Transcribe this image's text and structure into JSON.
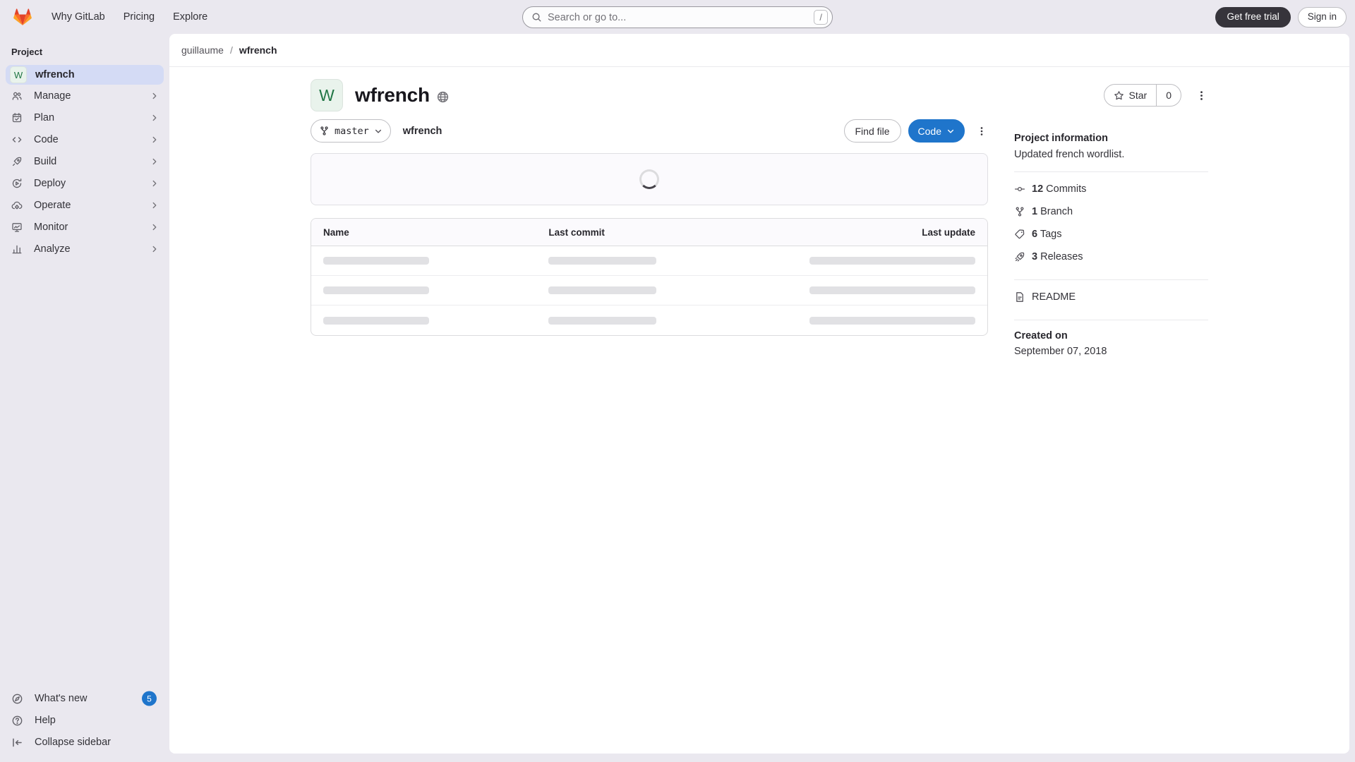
{
  "topbar": {
    "links": [
      {
        "label": "Why GitLab"
      },
      {
        "label": "Pricing"
      },
      {
        "label": "Explore"
      }
    ],
    "search": {
      "placeholder": "Search or go to...",
      "shortcut_key": "/"
    },
    "trial_button": "Get free trial",
    "signin_button": "Sign in"
  },
  "sidebar": {
    "heading": "Project",
    "project_item": {
      "initial": "W",
      "label": "wfrench"
    },
    "items": [
      {
        "icon": "manage-icon",
        "label": "Manage"
      },
      {
        "icon": "plan-icon",
        "label": "Plan"
      },
      {
        "icon": "code-icon",
        "label": "Code"
      },
      {
        "icon": "build-icon",
        "label": "Build"
      },
      {
        "icon": "deploy-icon",
        "label": "Deploy"
      },
      {
        "icon": "operate-icon",
        "label": "Operate"
      },
      {
        "icon": "monitor-icon",
        "label": "Monitor"
      },
      {
        "icon": "analyze-icon",
        "label": "Analyze"
      }
    ],
    "footer": [
      {
        "icon": "whats-new-icon",
        "label": "What's new",
        "badge": "5"
      },
      {
        "icon": "help-icon",
        "label": "Help"
      },
      {
        "icon": "collapse-sidebar-icon",
        "label": "Collapse sidebar"
      }
    ]
  },
  "breadcrumb": {
    "parent": "guillaume",
    "separator": "/",
    "current": "wfrench"
  },
  "project_header": {
    "avatar_initial": "W",
    "title": "wfrench",
    "visibility_icon": "globe-icon",
    "star_label": "Star",
    "star_count": "0"
  },
  "toolbar": {
    "branch": "master",
    "path_label": "wfrench",
    "find_file_label": "Find file",
    "code_label": "Code"
  },
  "file_table": {
    "headers": [
      "Name",
      "Last commit",
      "Last update"
    ],
    "skeleton_rows": 3,
    "state": "loading"
  },
  "project_info": {
    "title": "Project information",
    "description": "Updated french wordlist.",
    "stats": [
      {
        "icon": "commit-icon",
        "count": "12",
        "label": "Commits"
      },
      {
        "icon": "branch-icon",
        "count": "1",
        "label": "Branch"
      },
      {
        "icon": "tag-icon",
        "count": "6",
        "label": "Tags"
      },
      {
        "icon": "rocket-icon",
        "count": "3",
        "label": "Releases"
      }
    ],
    "readme_label": "README",
    "created_on_label": "Created on",
    "created_on_value": "September 07, 2018"
  },
  "colors": {
    "accent_blue": "#1f75cb",
    "badge_blue": "#1f75cb",
    "avatar_green_bg": "#e9f3ec",
    "avatar_green_text": "#217645",
    "chrome_background": "#eae8ef",
    "selected_item_bg": "#d4dbf5",
    "dark_button_bg": "#36343b",
    "logo_red": "#e24329",
    "logo_orange": "#fc6d26",
    "logo_yellow": "#fca326"
  }
}
